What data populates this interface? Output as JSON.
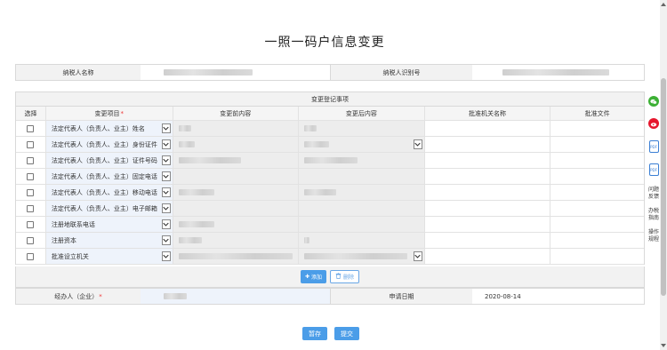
{
  "page": {
    "title": "一照一码户信息变更"
  },
  "taxpayer": {
    "name_label": "纳税人名称",
    "id_label": "纳税人识别号"
  },
  "table": {
    "caption": "变更登记事项",
    "headers": {
      "select": "选择",
      "item": "变更项目",
      "required_mark": "*",
      "before": "变更前内容",
      "after": "变更后内容",
      "authority": "批准机关名称",
      "file": "批准文件"
    },
    "rows": [
      {
        "item": "法定代表人（负责人、业主）姓名"
      },
      {
        "item": "法定代表人（负责人、业主）身份证件"
      },
      {
        "item": "法定代表人（负责人、业主）证件号码"
      },
      {
        "item": "法定代表人（负责人、业主）固定电话"
      },
      {
        "item": "法定代表人（负责人、业主）移动电话"
      },
      {
        "item": "法定代表人（负责人、业主）电子邮箱"
      },
      {
        "item": "注册地联系电话"
      },
      {
        "item": "注册资本"
      },
      {
        "item": "批准设立机关"
      }
    ]
  },
  "actions": {
    "add_label": "添加",
    "delete_label": "删除"
  },
  "operator": {
    "label": "经办人（企业）",
    "required_mark": "*",
    "date_label": "申请日期",
    "date_value": "2020-08-14"
  },
  "buttons": {
    "save": "暂存",
    "submit": "提交"
  },
  "sidebar": {
    "pdf1": "PDF",
    "pdf2": "PDF",
    "feedback": "问题反馈",
    "guide": "办税指南",
    "manual": "操作规程"
  },
  "colors": {
    "primary": "#4b9de8",
    "wechat": "#3cb034",
    "weibo": "#e6162d"
  }
}
